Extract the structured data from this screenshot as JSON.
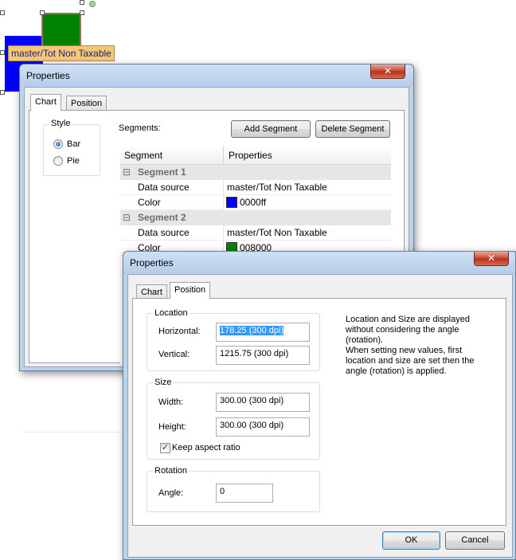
{
  "canvas": {
    "chart_tooltip": "master/Tot Non Taxable",
    "colors": {
      "bar_blue": "#0000ff",
      "bar_green": "#008000",
      "bar_green_border": "#8b7d5a"
    }
  },
  "dialog1": {
    "title": "Properties",
    "close_label": "✕",
    "tabs": [
      {
        "label": "Chart"
      },
      {
        "label": "Position"
      }
    ],
    "style_group": {
      "label": "Style",
      "options": [
        {
          "label": "Bar",
          "checked": true
        },
        {
          "label": "Pie",
          "checked": false
        }
      ]
    },
    "segments_label": "Segments:",
    "add_segment": "Add Segment",
    "delete_segment": "Delete Segment",
    "grid": {
      "headers": [
        "Segment",
        "Properties"
      ],
      "segments": [
        {
          "expander": "⊟",
          "title": "Segment 1",
          "data_source_label": "Data source",
          "data_source_value": "master/Tot Non Taxable",
          "color_label": "Color",
          "color_value": "0000ff",
          "color_hex": "#0000ff"
        },
        {
          "expander": "⊟",
          "title": "Segment 2",
          "data_source_label": "Data source",
          "data_source_value": "master/Tot Non Taxable",
          "color_label": "Color",
          "color_value": "008000",
          "color_hex": "#008000"
        }
      ]
    }
  },
  "dialog2": {
    "title": "Properties",
    "close_label": "✕",
    "tabs": [
      {
        "label": "Chart"
      },
      {
        "label": "Position"
      }
    ],
    "location": {
      "label": "Location",
      "horizontal_label": "Horizontal:",
      "horizontal_value": "178.25 (300 dpi)",
      "vertical_label": "Vertical:",
      "vertical_value": "1215.75 (300 dpi)"
    },
    "size": {
      "label": "Size",
      "width_label": "Width:",
      "width_value": "300.00 (300 dpi)",
      "height_label": "Height:",
      "height_value": "300.00 (300 dpi)",
      "keep_aspect_label": "Keep aspect ratio",
      "keep_aspect_checked": true
    },
    "rotation": {
      "label": "Rotation",
      "angle_label": "Angle:",
      "angle_value": "0"
    },
    "info_lines": [
      "Location and Size are displayed",
      "without considering the angle",
      "(rotation).",
      "When setting new values, first",
      "location and size are set then the",
      "angle (rotation) is applied."
    ],
    "ok_label": "OK",
    "cancel_label": "Cancel"
  }
}
